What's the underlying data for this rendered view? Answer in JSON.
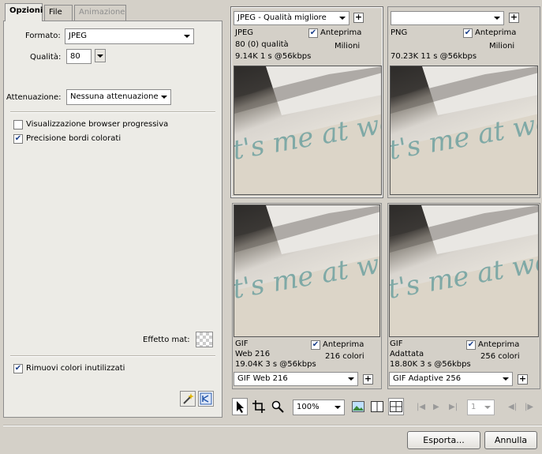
{
  "tabs": [
    {
      "label": "Opzioni",
      "active": true
    },
    {
      "label": "File",
      "active": false
    },
    {
      "label": "Animazione",
      "active": false,
      "disabled": true
    }
  ],
  "options": {
    "format_label": "Formato:",
    "format_value": "JPEG",
    "quality_label": "Qualità:",
    "quality_value": "80",
    "smoothing_label": "Attenuazione:",
    "smoothing_value": "Nessuna attenuazione",
    "progressive_label": "Visualizzazione browser progressiva",
    "progressive_checked": false,
    "sharpen_edges_label": "Precisione bordi colorati",
    "sharpen_edges_checked": true,
    "matte_label": "Effetto mat:",
    "remove_unused_label": "Rimuovi colori inutilizzati",
    "remove_unused_checked": true
  },
  "previews": [
    {
      "preset": "JPEG - Qualità migliore",
      "format": "JPEG",
      "detail": "80 (0) qualità",
      "preview_label": "Anteprima",
      "preview_checked": true,
      "colors": "Milioni",
      "size_time": "9.14K  1 s @56kbps",
      "selected": true
    },
    {
      "preset": "",
      "format": "PNG",
      "detail": "",
      "preview_label": "Anteprima",
      "preview_checked": true,
      "colors": "Milioni",
      "size_time": "70.23K  11 s @56kbps",
      "selected": false
    },
    {
      "preset": "GIF Web 216",
      "format": "GIF",
      "detail": "Web 216",
      "preview_label": "Anteprima",
      "preview_checked": true,
      "colors": "216 colori",
      "size_time": "19.04K  3 s @56kbps",
      "selected": false
    },
    {
      "preset": "GIF Adaptive 256",
      "format": "GIF",
      "detail": "Adattata",
      "preview_label": "Anteprima",
      "preview_checked": true,
      "colors": "256 colori",
      "size_time": "18.80K  3 s @56kbps",
      "selected": false
    }
  ],
  "image_text": "t's me at work",
  "toolbar": {
    "zoom_value": "100%",
    "frame_value": "1"
  },
  "buttons": {
    "export": "Esporta...",
    "cancel": "Annulla"
  },
  "colors": {
    "panel_bg": "#ecebe6",
    "window_bg": "#d4d0c8",
    "script_text": "#7fa9a6"
  }
}
